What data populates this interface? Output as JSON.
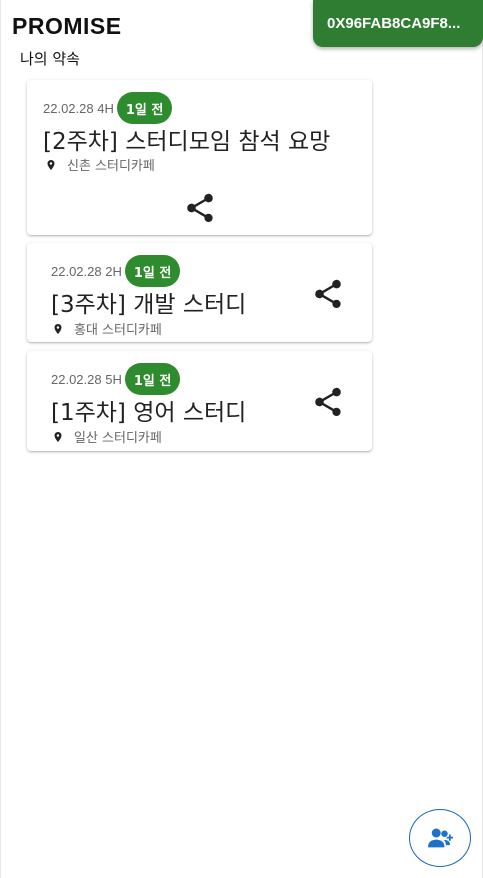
{
  "header": {
    "app_title": "PROMISE",
    "subtitle": "나의 약속",
    "wallet_address": "0X96FAB8CA9F8..."
  },
  "promises": [
    {
      "date": "22.02.28 4H",
      "badge": "1일 전",
      "title": "[2주차] 스터디모임 참석 요망",
      "location": "신촌 스터디카페",
      "share_icon": "share-icon"
    },
    {
      "date": "22.02.28 2H",
      "badge": "1일 전",
      "title": "[3주차] 개발 스터디",
      "location": "홍대 스터디카페",
      "share_icon": "share-icon"
    },
    {
      "date": "22.02.28 5H",
      "badge": "1일 전",
      "title": "[1주차] 영어 스터디",
      "location": "일산 스터디카페",
      "share_icon": "share-icon"
    }
  ],
  "fab": {
    "icon": "add-friend-icon"
  },
  "colors": {
    "primary_green": "#2e7d32",
    "badge_green": "#2e8b2e",
    "fab_blue": "#1565c0"
  }
}
